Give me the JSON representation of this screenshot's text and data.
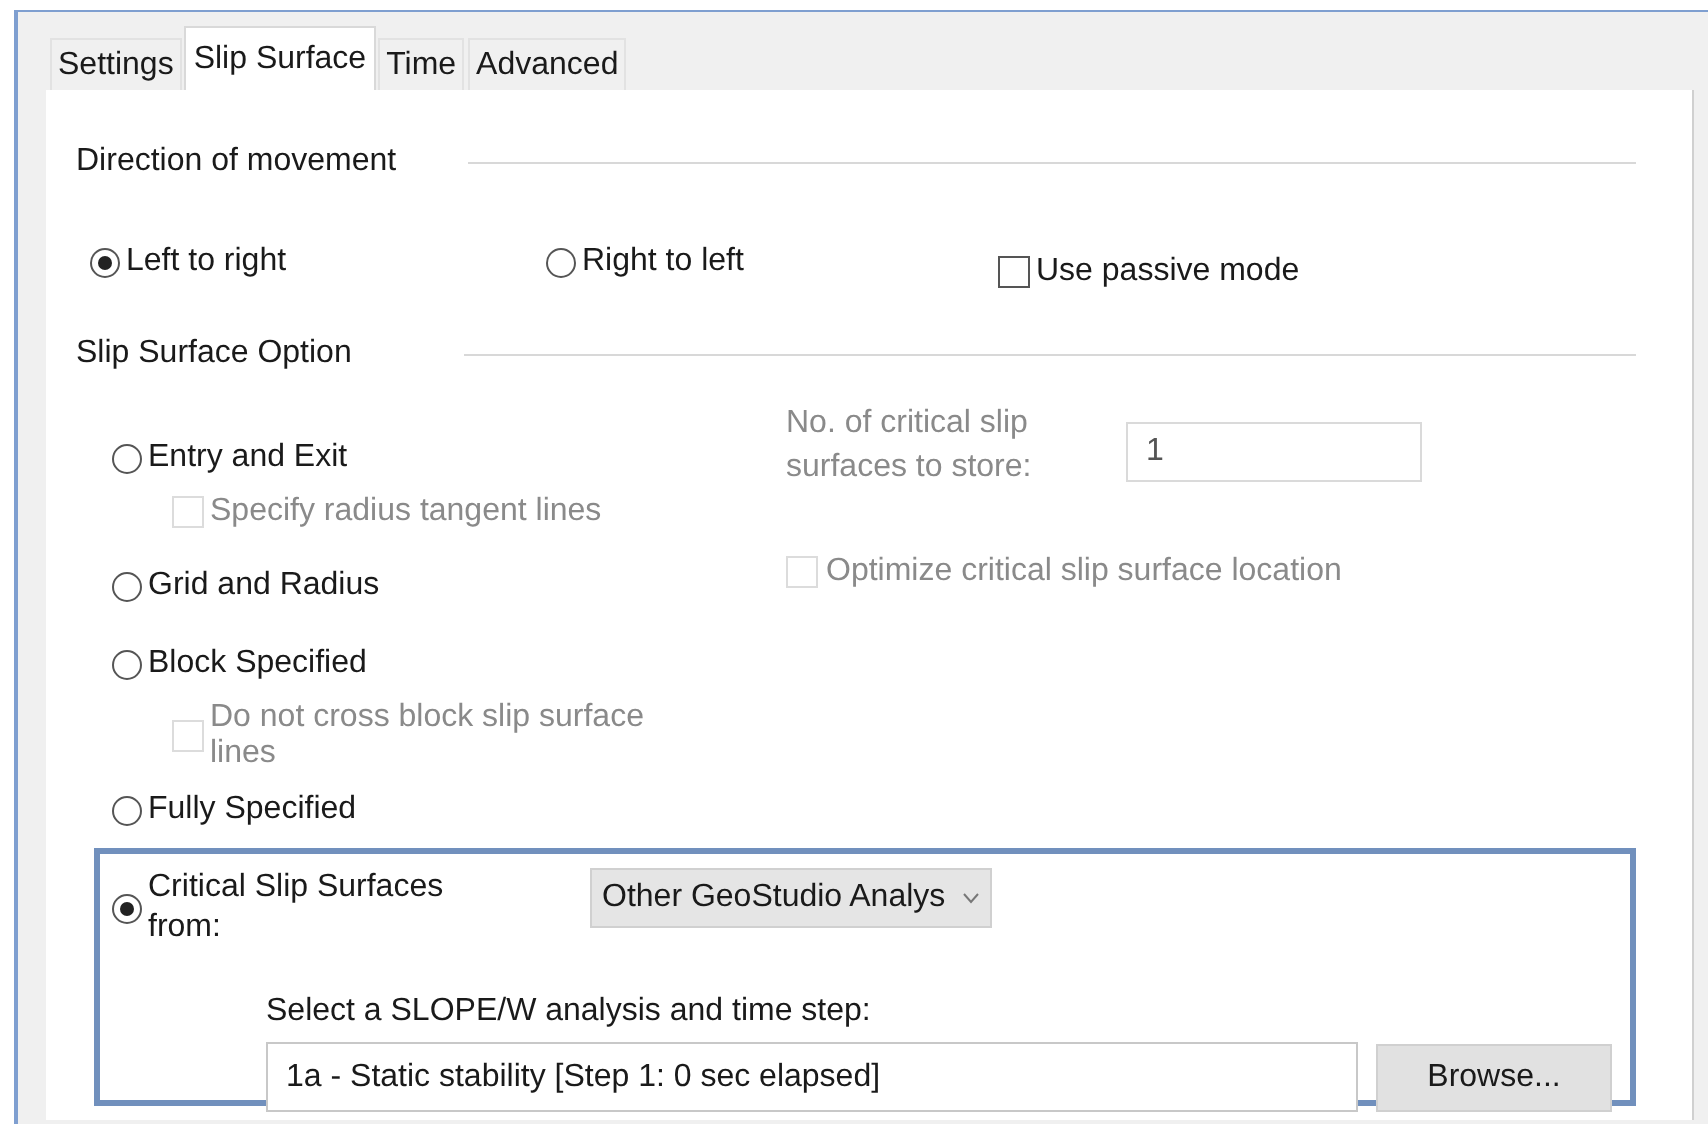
{
  "tabs": [
    {
      "label": "Settings",
      "selected": false
    },
    {
      "label": "Slip Surface",
      "selected": true
    },
    {
      "label": "Time",
      "selected": false
    },
    {
      "label": "Advanced",
      "selected": false
    }
  ],
  "direction": {
    "heading": "Direction of movement",
    "options": [
      {
        "label": "Left to right",
        "selected": true
      },
      {
        "label": "Right to left",
        "selected": false
      }
    ],
    "passive_mode": {
      "label": "Use passive mode",
      "checked": false
    }
  },
  "slip_surface_option": {
    "heading": "Slip Surface Option",
    "options": [
      {
        "label": "Entry and Exit",
        "selected": false,
        "sub_option": {
          "label": "Specify radius tangent lines",
          "checked": false,
          "disabled": true
        }
      },
      {
        "label": "Grid and Radius",
        "selected": false
      },
      {
        "label": "Block Specified",
        "selected": false,
        "sub_option": {
          "label": "Do not cross block slip surface lines",
          "checked": false,
          "disabled": true
        }
      },
      {
        "label": "Fully Specified",
        "selected": false
      },
      {
        "label": "Critical Slip Surfaces from:",
        "selected": true
      }
    ],
    "store_count": {
      "label": "No. of critical slip surfaces to store:",
      "value": "1",
      "disabled": true
    },
    "optimize": {
      "label": "Optimize critical slip surface location",
      "checked": false,
      "disabled": true
    },
    "source": {
      "dropdown": "Other GeoStudio Analys",
      "prompt": "Select a SLOPE/W analysis and time step:",
      "analysis": "1a - Static stability [Step 1: 0 sec elapsed]",
      "browse": "Browse..."
    }
  }
}
